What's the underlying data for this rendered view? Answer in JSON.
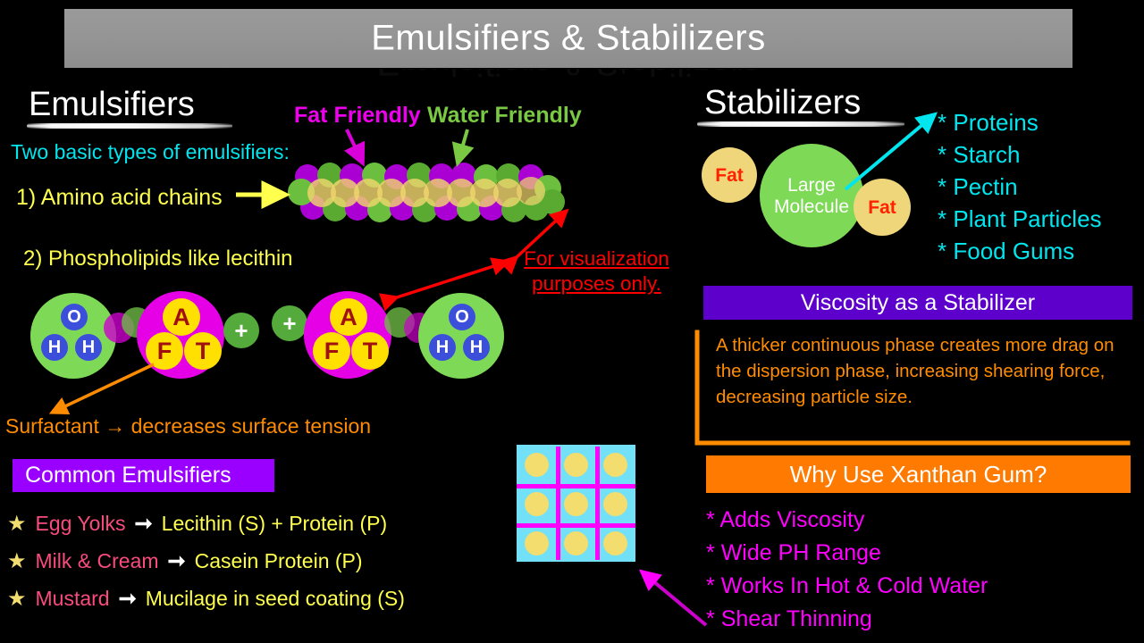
{
  "header": {
    "title": "Emulsifiers & Stabilizers",
    "bar_color": "#949494"
  },
  "left": {
    "heading": "Emulsifiers",
    "lead": "Two basic types of emulsifiers:",
    "type1": "1) Amino acid chains",
    "type2": "2) Phospholipids like lecithin",
    "fat_friendly_label": "Fat Friendly",
    "water_friendly_label": "Water Friendly",
    "fat_friendly_color": "#ee00ee",
    "water_friendly_color": "#7ac943",
    "disclaimer_line1": "For visualization",
    "disclaimer_line2": "purposes only.",
    "disclaimer_color": "#ff0000",
    "surfactant_note": "Surfactant → decreases surface tension",
    "surfactant_color": "#ff8c00",
    "molecule_labels": {
      "oxygen": "O",
      "hydrogen": "H",
      "head_a": "A",
      "head_f": "F",
      "head_t": "T",
      "plus": "+"
    }
  },
  "common_emulsifiers": {
    "title": "Common Emulsifiers",
    "title_bg": "#9900ff",
    "rows": [
      {
        "bullet": "★",
        "source": "Egg Yolks",
        "arrow": "➞",
        "result": "Lecithin (S) + Protein (P)"
      },
      {
        "bullet": "★",
        "source": "Milk & Cream",
        "arrow": "➞",
        "result": "Casein Protein (P)"
      },
      {
        "bullet": "★",
        "source": "Mustard",
        "arrow": "➞",
        "result": "Mucilage in seed coating (S)"
      }
    ]
  },
  "right": {
    "heading": "Stabilizers",
    "diagram": {
      "fat_left": "Fat",
      "fat_right": "Fat",
      "large_molecule_line1": "Large",
      "large_molecule_line2": "Molecule",
      "molecule_color": "#7ed957",
      "fat_color": "#f0d67a"
    },
    "stabilizer_list": [
      {
        "bullet": "*",
        "label": "Proteins",
        "underline": false
      },
      {
        "bullet": "*",
        "label": "Starch",
        "underline": false
      },
      {
        "bullet": "*",
        "label": "Pectin",
        "underline": false
      },
      {
        "bullet": "*",
        "label": "Plant Particles",
        "underline": false
      },
      {
        "bullet": "*",
        "label": "Food Gums",
        "underline": true
      }
    ],
    "list_color": "#00e5ee"
  },
  "viscosity": {
    "title": "Viscosity as a Stabilizer",
    "title_bg": "#5d00cc",
    "body": "A thicker continuous phase creates more drag on the dispersion phase, increasing shearing force, decreasing particle size.",
    "body_color": "#ff8c00"
  },
  "xanthan": {
    "title": "Why Use Xanthan Gum?",
    "title_bg": "#ff7a00",
    "items": [
      {
        "bullet": "*",
        "label": "Adds Viscosity"
      },
      {
        "bullet": "*",
        "label": "Wide PH Range"
      },
      {
        "bullet": "*",
        "label": "Works In Hot & Cold Water"
      },
      {
        "bullet": "*",
        "label": "Shear Thinning"
      }
    ],
    "item_color": "#ff00ff"
  },
  "particle_grid": {
    "background": "#72e0f7",
    "grid_color": "#ff00ff",
    "dot_color": "#f2dd6e",
    "rows": 3,
    "cols": 3
  }
}
